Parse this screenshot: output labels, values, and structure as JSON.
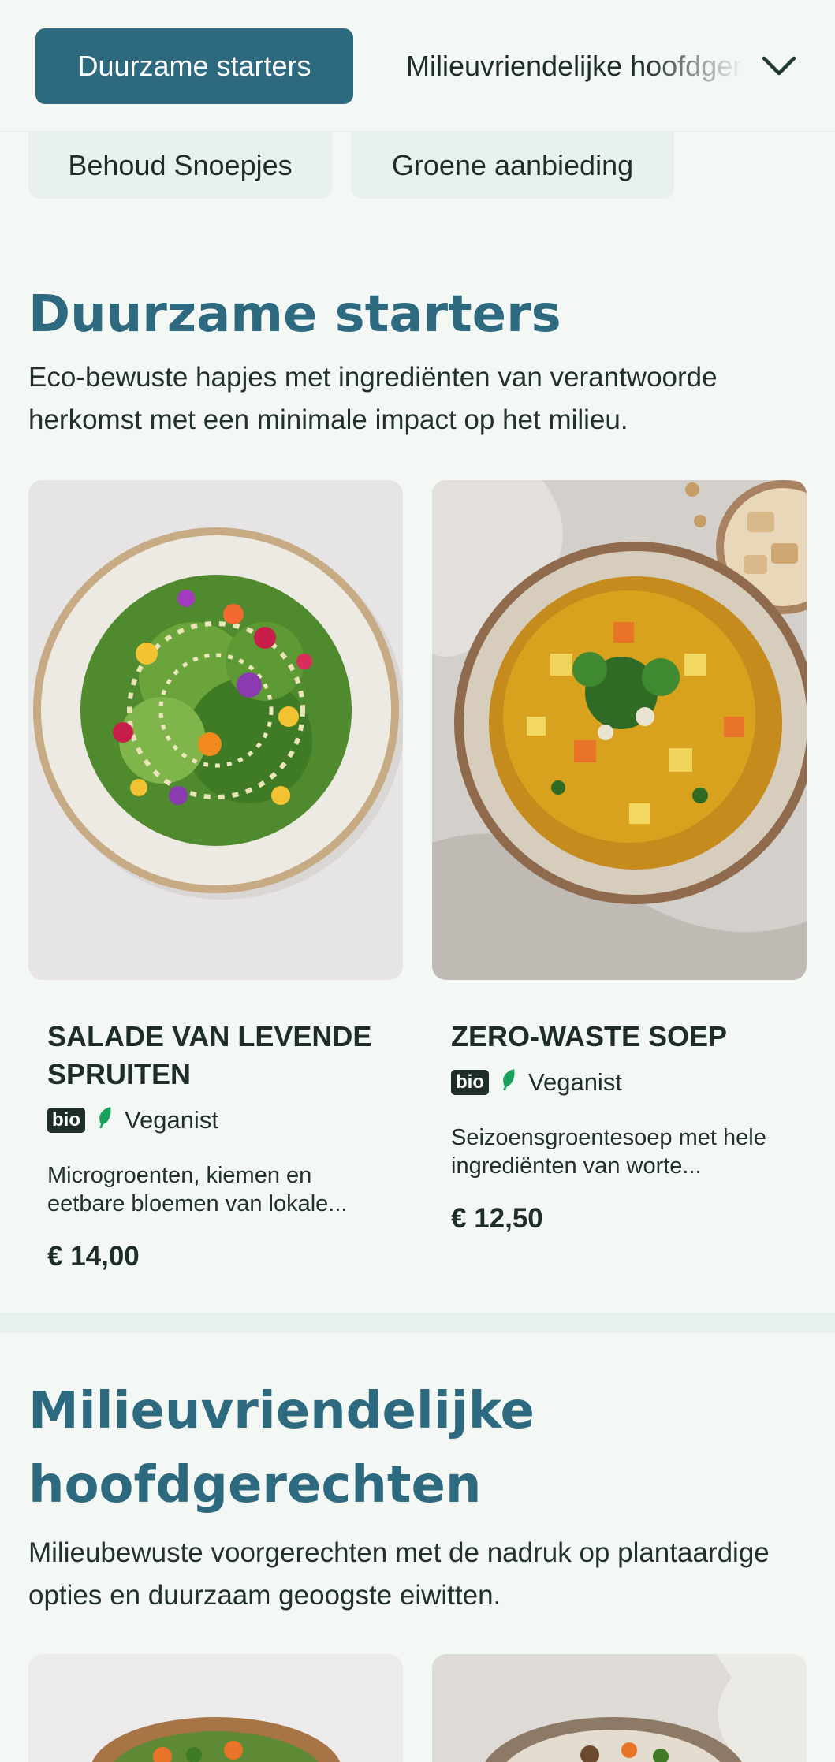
{
  "nav": {
    "tabs": [
      "Duurzame starters",
      "Milieuvriendelijke hoofdgerechten"
    ],
    "pills": [
      "Behoud Snoepjes",
      "Groene aanbieding"
    ],
    "dropdown_icon": "chevron-down-icon"
  },
  "sections": [
    {
      "title": "Duurzame starters",
      "description": "Eco-bewuste hapjes met ingrediënten van verantwoorde herkomst met een minimale impact op het milieu.",
      "items": [
        {
          "name": "SALADE VAN LEVENDE SPRUITEN",
          "badge": "bio",
          "diet": "Veganist",
          "description": "Microgroenten, kiemen en eetbare bloemen van lokale...",
          "price": "€ 14,00"
        },
        {
          "name": "ZERO-WASTE SOEP",
          "badge": "bio",
          "diet": "Veganist",
          "description": "Seizoensgroentesoep met hele ingrediënten van worte...",
          "price": "€ 12,50"
        }
      ]
    },
    {
      "title": "Milieuvriendelijke hoofdgerechten",
      "description": "Milieubewuste voorgerechten met de nadruk op plantaardige opties en duurzaam geoogste eiwitten."
    }
  ],
  "colors": {
    "accent": "#2d6a80",
    "background": "#f3f8f4",
    "leaf": "#1aa05a"
  }
}
